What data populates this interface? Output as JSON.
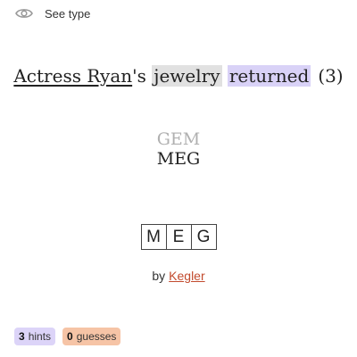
{
  "top": {
    "toggle_label": "See type",
    "toggle_icon": "eye-icon"
  },
  "clue": {
    "part1": "Actress Ryan",
    "part2": "'s ",
    "part3": "jewelry",
    "part4": " ",
    "part5": "returned",
    "enumeration": "(3)"
  },
  "wordplay": {
    "line1": "GEM",
    "line2": "MEG"
  },
  "answer": {
    "letters": [
      "M",
      "E",
      "G"
    ]
  },
  "byline": {
    "prefix": "by",
    "author": "Kegler"
  },
  "stats": {
    "hints_count": "3",
    "hints_label": "hints",
    "guesses_count": "0",
    "guesses_label": "guesses"
  },
  "colors": {
    "highlight_gray": "#e1e1e1",
    "highlight_purple": "#d9d2f7",
    "author_link": "#c24a2d",
    "hints_badge": "#dcd4f8",
    "guesses_badge": "#f6c4a6"
  }
}
